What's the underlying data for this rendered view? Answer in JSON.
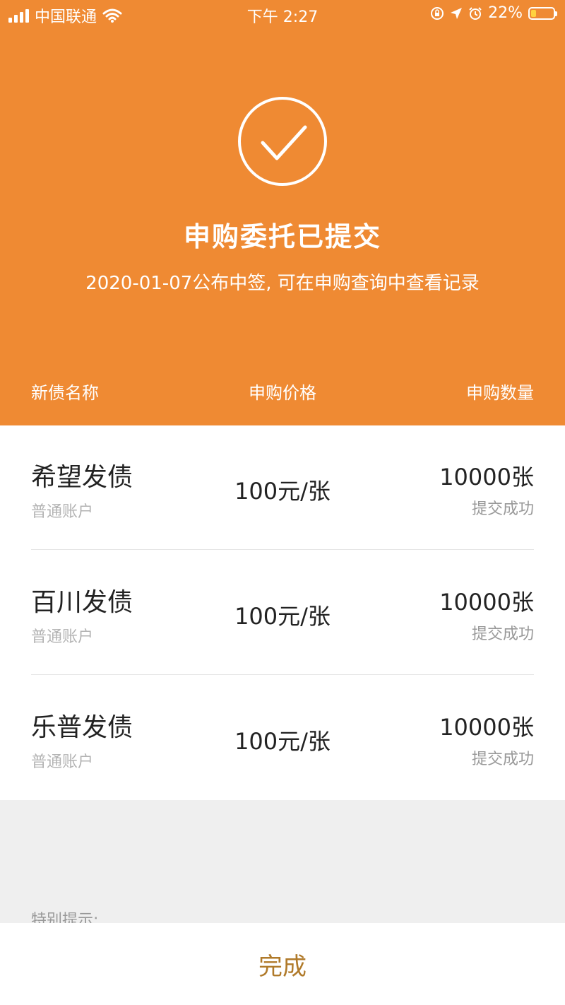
{
  "status_bar": {
    "carrier": "中国联通",
    "time": "下午 2:27",
    "battery_percent": "22%",
    "battery_level": 0.22,
    "icons": [
      "signal-icon",
      "wifi-icon",
      "orientation-lock-icon",
      "location-icon",
      "alarm-icon",
      "battery-icon"
    ]
  },
  "header": {
    "icon": "check-circle-icon",
    "title": "申购委托已提交",
    "subtitle": "2020-01-07公布中签, 可在申购查询中查看记录",
    "columns": {
      "name": "新债名称",
      "price": "申购价格",
      "quantity": "申购数量"
    },
    "accent_color": "#ef8a33"
  },
  "orders": [
    {
      "name": "希望发债",
      "account": "普通账户",
      "price": "100元/张",
      "quantity": "10000张",
      "status": "提交成功"
    },
    {
      "name": "百川发债",
      "account": "普通账户",
      "price": "100元/张",
      "quantity": "10000张",
      "status": "提交成功"
    },
    {
      "name": "乐普发债",
      "account": "普通账户",
      "price": "100元/张",
      "quantity": "10000张",
      "status": "提交成功"
    }
  ],
  "notice": {
    "label": "特别提示:"
  },
  "footer": {
    "done_label": "完成",
    "done_color": "#b07a2a"
  }
}
